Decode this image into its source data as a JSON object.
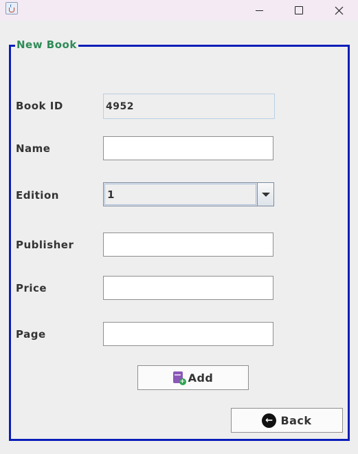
{
  "window": {
    "title": "",
    "icon": "java-icon"
  },
  "form": {
    "title": "New Book",
    "fields": {
      "book_id": {
        "label": "Book ID",
        "value": "4952"
      },
      "name": {
        "label": "Name",
        "value": ""
      },
      "edition": {
        "label": "Edition",
        "selected": "1"
      },
      "publisher": {
        "label": "Publisher",
        "value": ""
      },
      "price": {
        "label": "Price",
        "value": ""
      },
      "page": {
        "label": "Page",
        "value": ""
      }
    },
    "border_color": "#0a1db8",
    "title_color": "#2e8b57"
  },
  "buttons": {
    "add": {
      "label": "Add",
      "icon": "add-book-icon"
    },
    "back": {
      "label": "Back",
      "icon": "back-arrow-icon"
    }
  }
}
